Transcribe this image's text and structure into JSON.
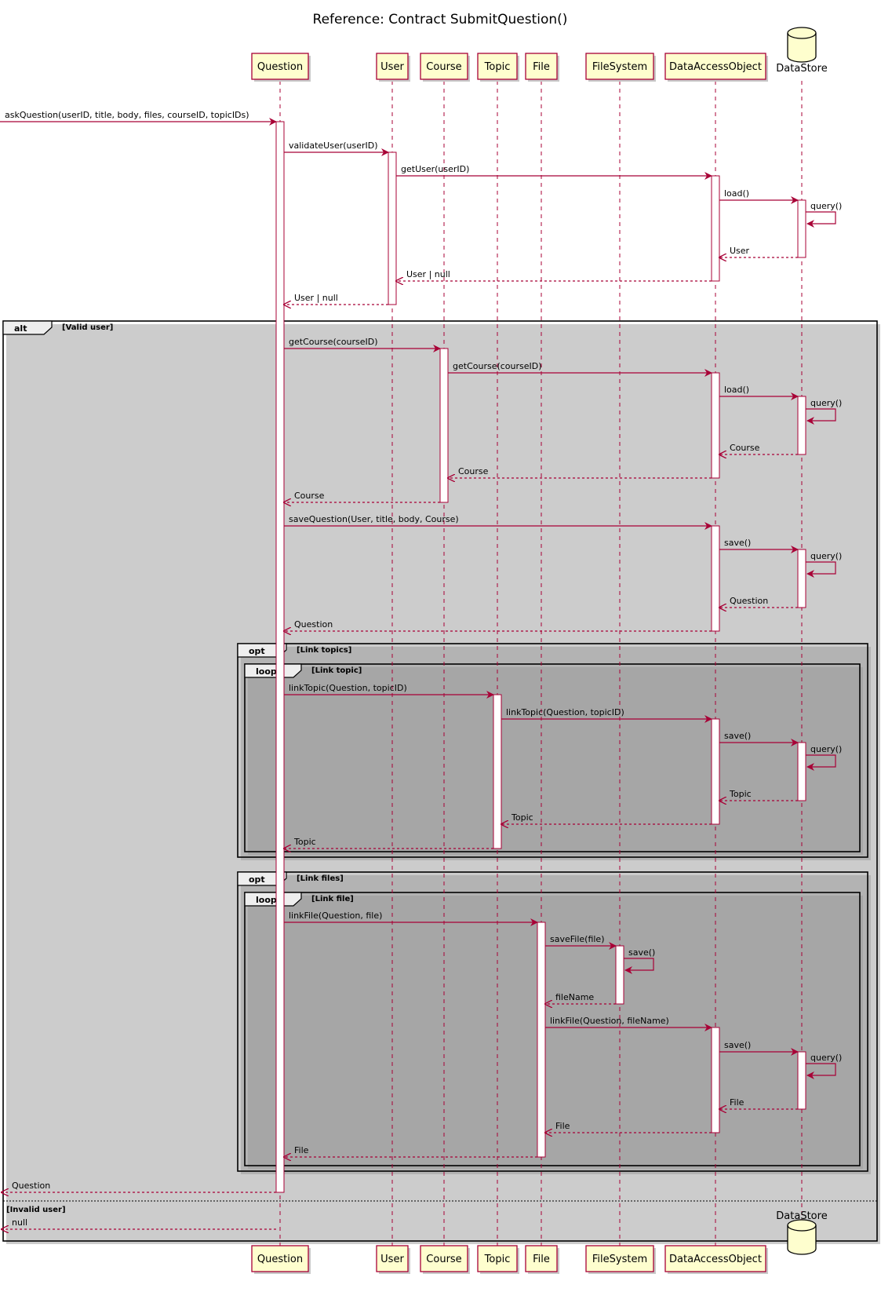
{
  "title": "Reference: Contract SubmitQuestion()",
  "participants": [
    {
      "id": "question",
      "label": "Question",
      "kind": "participant"
    },
    {
      "id": "user",
      "label": "User",
      "kind": "participant"
    },
    {
      "id": "course",
      "label": "Course",
      "kind": "participant"
    },
    {
      "id": "topic",
      "label": "Topic",
      "kind": "participant"
    },
    {
      "id": "file",
      "label": "File",
      "kind": "participant"
    },
    {
      "id": "filesystem",
      "label": "FileSystem",
      "kind": "participant"
    },
    {
      "id": "dao",
      "label": "DataAccessObject",
      "kind": "participant"
    },
    {
      "id": "datastore",
      "label": "DataStore",
      "kind": "database"
    }
  ],
  "messages": [
    {
      "from": "external",
      "to": "question",
      "label": "askQuestion(userID, title, body, files, courseID, topicIDs)",
      "kind": "call"
    },
    {
      "from": "question",
      "to": "user",
      "label": "validateUser(userID)",
      "kind": "call"
    },
    {
      "from": "user",
      "to": "dao",
      "label": "getUser(userID)",
      "kind": "call"
    },
    {
      "from": "dao",
      "to": "datastore",
      "label": "load()",
      "kind": "call"
    },
    {
      "from": "datastore",
      "to": "datastore",
      "label": "query()",
      "kind": "self"
    },
    {
      "from": "datastore",
      "to": "dao",
      "label": "User",
      "kind": "return"
    },
    {
      "from": "dao",
      "to": "user",
      "label": "User | null",
      "kind": "return"
    },
    {
      "from": "user",
      "to": "question",
      "label": "User | null",
      "kind": "return"
    },
    {
      "from": "question",
      "to": "course",
      "label": "getCourse(courseID)",
      "kind": "call"
    },
    {
      "from": "course",
      "to": "dao",
      "label": "getCourse(courseID)",
      "kind": "call"
    },
    {
      "from": "dao",
      "to": "datastore",
      "label": "load()",
      "kind": "call"
    },
    {
      "from": "datastore",
      "to": "datastore",
      "label": "query()",
      "kind": "self"
    },
    {
      "from": "datastore",
      "to": "dao",
      "label": "Course",
      "kind": "return"
    },
    {
      "from": "dao",
      "to": "course",
      "label": "Course",
      "kind": "return"
    },
    {
      "from": "course",
      "to": "question",
      "label": "Course",
      "kind": "return"
    },
    {
      "from": "question",
      "to": "dao",
      "label": "saveQuestion(User, title, body, Course)",
      "kind": "call"
    },
    {
      "from": "dao",
      "to": "datastore",
      "label": "save()",
      "kind": "call"
    },
    {
      "from": "datastore",
      "to": "datastore",
      "label": "query()",
      "kind": "self"
    },
    {
      "from": "datastore",
      "to": "dao",
      "label": "Question",
      "kind": "return"
    },
    {
      "from": "dao",
      "to": "question",
      "label": "Question",
      "kind": "return"
    },
    {
      "from": "question",
      "to": "topic",
      "label": "linkTopic(Question, topicID)",
      "kind": "call"
    },
    {
      "from": "topic",
      "to": "dao",
      "label": "linkTopic(Question, topicID)",
      "kind": "call"
    },
    {
      "from": "dao",
      "to": "datastore",
      "label": "save()",
      "kind": "call"
    },
    {
      "from": "datastore",
      "to": "datastore",
      "label": "query()",
      "kind": "self"
    },
    {
      "from": "datastore",
      "to": "dao",
      "label": "Topic",
      "kind": "return"
    },
    {
      "from": "dao",
      "to": "topic",
      "label": "Topic",
      "kind": "return"
    },
    {
      "from": "topic",
      "to": "question",
      "label": "Topic",
      "kind": "return"
    },
    {
      "from": "question",
      "to": "file",
      "label": "linkFile(Question, file)",
      "kind": "call"
    },
    {
      "from": "file",
      "to": "filesystem",
      "label": "saveFile(file)",
      "kind": "call"
    },
    {
      "from": "filesystem",
      "to": "filesystem",
      "label": "save()",
      "kind": "self"
    },
    {
      "from": "filesystem",
      "to": "file",
      "label": "fileName",
      "kind": "return"
    },
    {
      "from": "file",
      "to": "dao",
      "label": "linkFile(Question, fileName)",
      "kind": "call"
    },
    {
      "from": "dao",
      "to": "datastore",
      "label": "save()",
      "kind": "call"
    },
    {
      "from": "datastore",
      "to": "datastore",
      "label": "query()",
      "kind": "self"
    },
    {
      "from": "datastore",
      "to": "dao",
      "label": "File",
      "kind": "return"
    },
    {
      "from": "dao",
      "to": "file",
      "label": "File",
      "kind": "return"
    },
    {
      "from": "file",
      "to": "question",
      "label": "File",
      "kind": "return"
    },
    {
      "from": "question",
      "to": "external",
      "label": "Question",
      "kind": "return"
    },
    {
      "from": "question",
      "to": "external",
      "label": "null",
      "kind": "return"
    }
  ],
  "fragments": [
    {
      "keyword": "alt",
      "guard": "[Valid user]",
      "else_guard": "[Invalid user]"
    },
    {
      "keyword": "opt",
      "guard": "[Link topics]"
    },
    {
      "keyword": "loop",
      "guard": "[Link topic]"
    },
    {
      "keyword": "opt",
      "guard": "[Link files]"
    },
    {
      "keyword": "loop",
      "guard": "[Link file]"
    }
  ],
  "colors": {
    "arrow": "#A80036",
    "participant_fill": "#FEFECE",
    "participant_border": "#A80036",
    "frame_border": "#000000",
    "frame_shadow": "#999999",
    "frame_tab_fill": "#EEEEEE"
  }
}
